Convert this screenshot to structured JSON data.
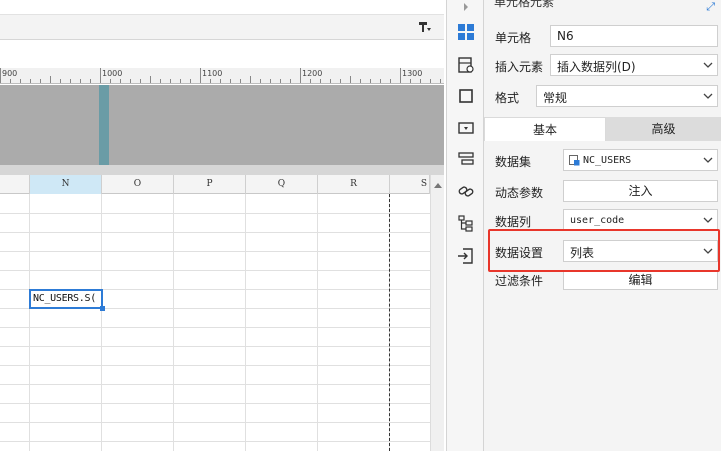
{
  "ruler": {
    "labels": [
      "900",
      "1000",
      "1100",
      "1200",
      "1300"
    ]
  },
  "grid": {
    "columns": [
      "N",
      "O",
      "P",
      "Q",
      "R",
      "S"
    ],
    "selected_column": "N",
    "selected_cell_value": "NC_USERS.S("
  },
  "panel": {
    "title": "单元格元素",
    "cell_label": "单元格",
    "cell_value": "N6",
    "insert_label": "插入元素",
    "insert_value": "插入数据列(D)",
    "format_label": "格式",
    "format_value": "常规",
    "tabs": {
      "basic": "基本",
      "advanced": "高级"
    },
    "dataset_label": "数据集",
    "dataset_value": "NC_USERS",
    "dynamic_label": "动态参数",
    "dynamic_button": "注入",
    "column_label": "数据列",
    "column_value": "user_code",
    "setting_label": "数据设置",
    "setting_value": "列表",
    "filter_label": "过滤条件",
    "filter_button": "编辑"
  },
  "colors": {
    "accent": "#2d7bd6",
    "highlight": "#e8362b",
    "selected_column_bg": "#cfe8f6"
  },
  "rail_icons": [
    "cell-element-icon",
    "cell-attribute-icon",
    "border-icon",
    "widget-icon",
    "condition-icon",
    "hyperlink-icon",
    "tree-icon",
    "import-icon"
  ]
}
